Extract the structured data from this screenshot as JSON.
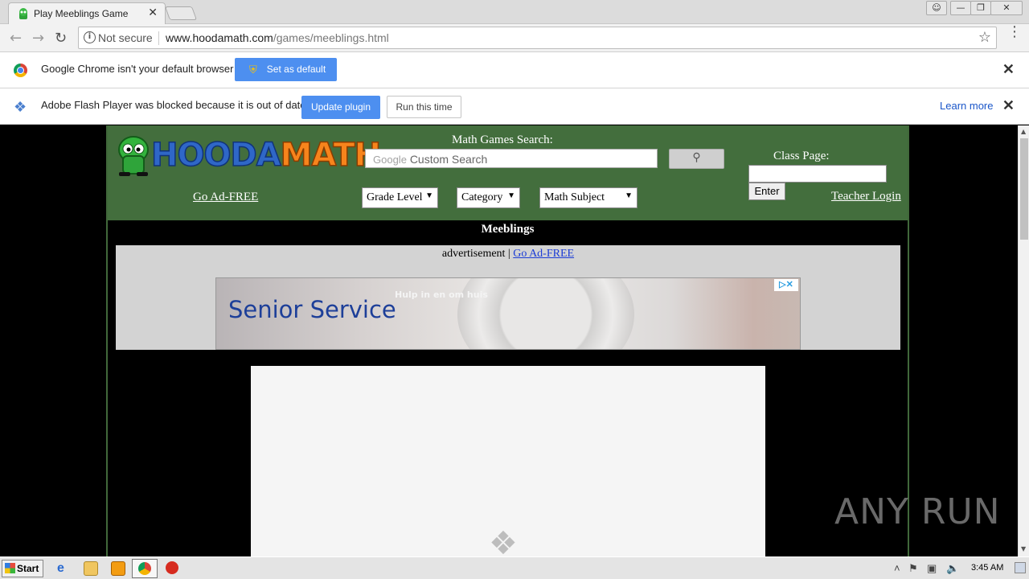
{
  "browser": {
    "tab_title": "Play Meeblings Game",
    "tab_close": "✕",
    "not_secure": "Not secure",
    "url_host": "www.hoodamath.com",
    "url_path": "/games/meeblings.html"
  },
  "infobar_default": {
    "message": "Google Chrome isn't your default browser",
    "button": "Set as default"
  },
  "infobar_flash": {
    "message": "Adobe Flash Player was blocked because it is out of date",
    "update_button": "Update plugin",
    "run_button": "Run this time",
    "learn_more": "Learn more"
  },
  "site": {
    "logo_hooda": "HOODA",
    "logo_math": "MATH",
    "go_ad_free": "Go Ad-FREE",
    "search_label": "Math Games Search:",
    "search_google": "Google",
    "search_placeholder": "Custom Search",
    "grade_level": "Grade Level",
    "category": "Category",
    "math_subject": "Math Subject",
    "class_page_label": "Class Page:",
    "enter_button": "Enter",
    "teacher_login": "Teacher Login",
    "game_title": "Meeblings",
    "ad_label": "advertisement |",
    "ad_go_ad_free": "Go Ad-FREE",
    "ad_headline": "Senior Service",
    "ad_sub": "Hulp in en om huis"
  },
  "taskbar": {
    "start": "Start",
    "clock": "3:45 AM"
  },
  "watermark": "ANY RUN",
  "colors": {
    "header_green": "#436e3d",
    "chrome_blue_button": "#4d8ff0",
    "link_blue": "#1a3bd6"
  }
}
